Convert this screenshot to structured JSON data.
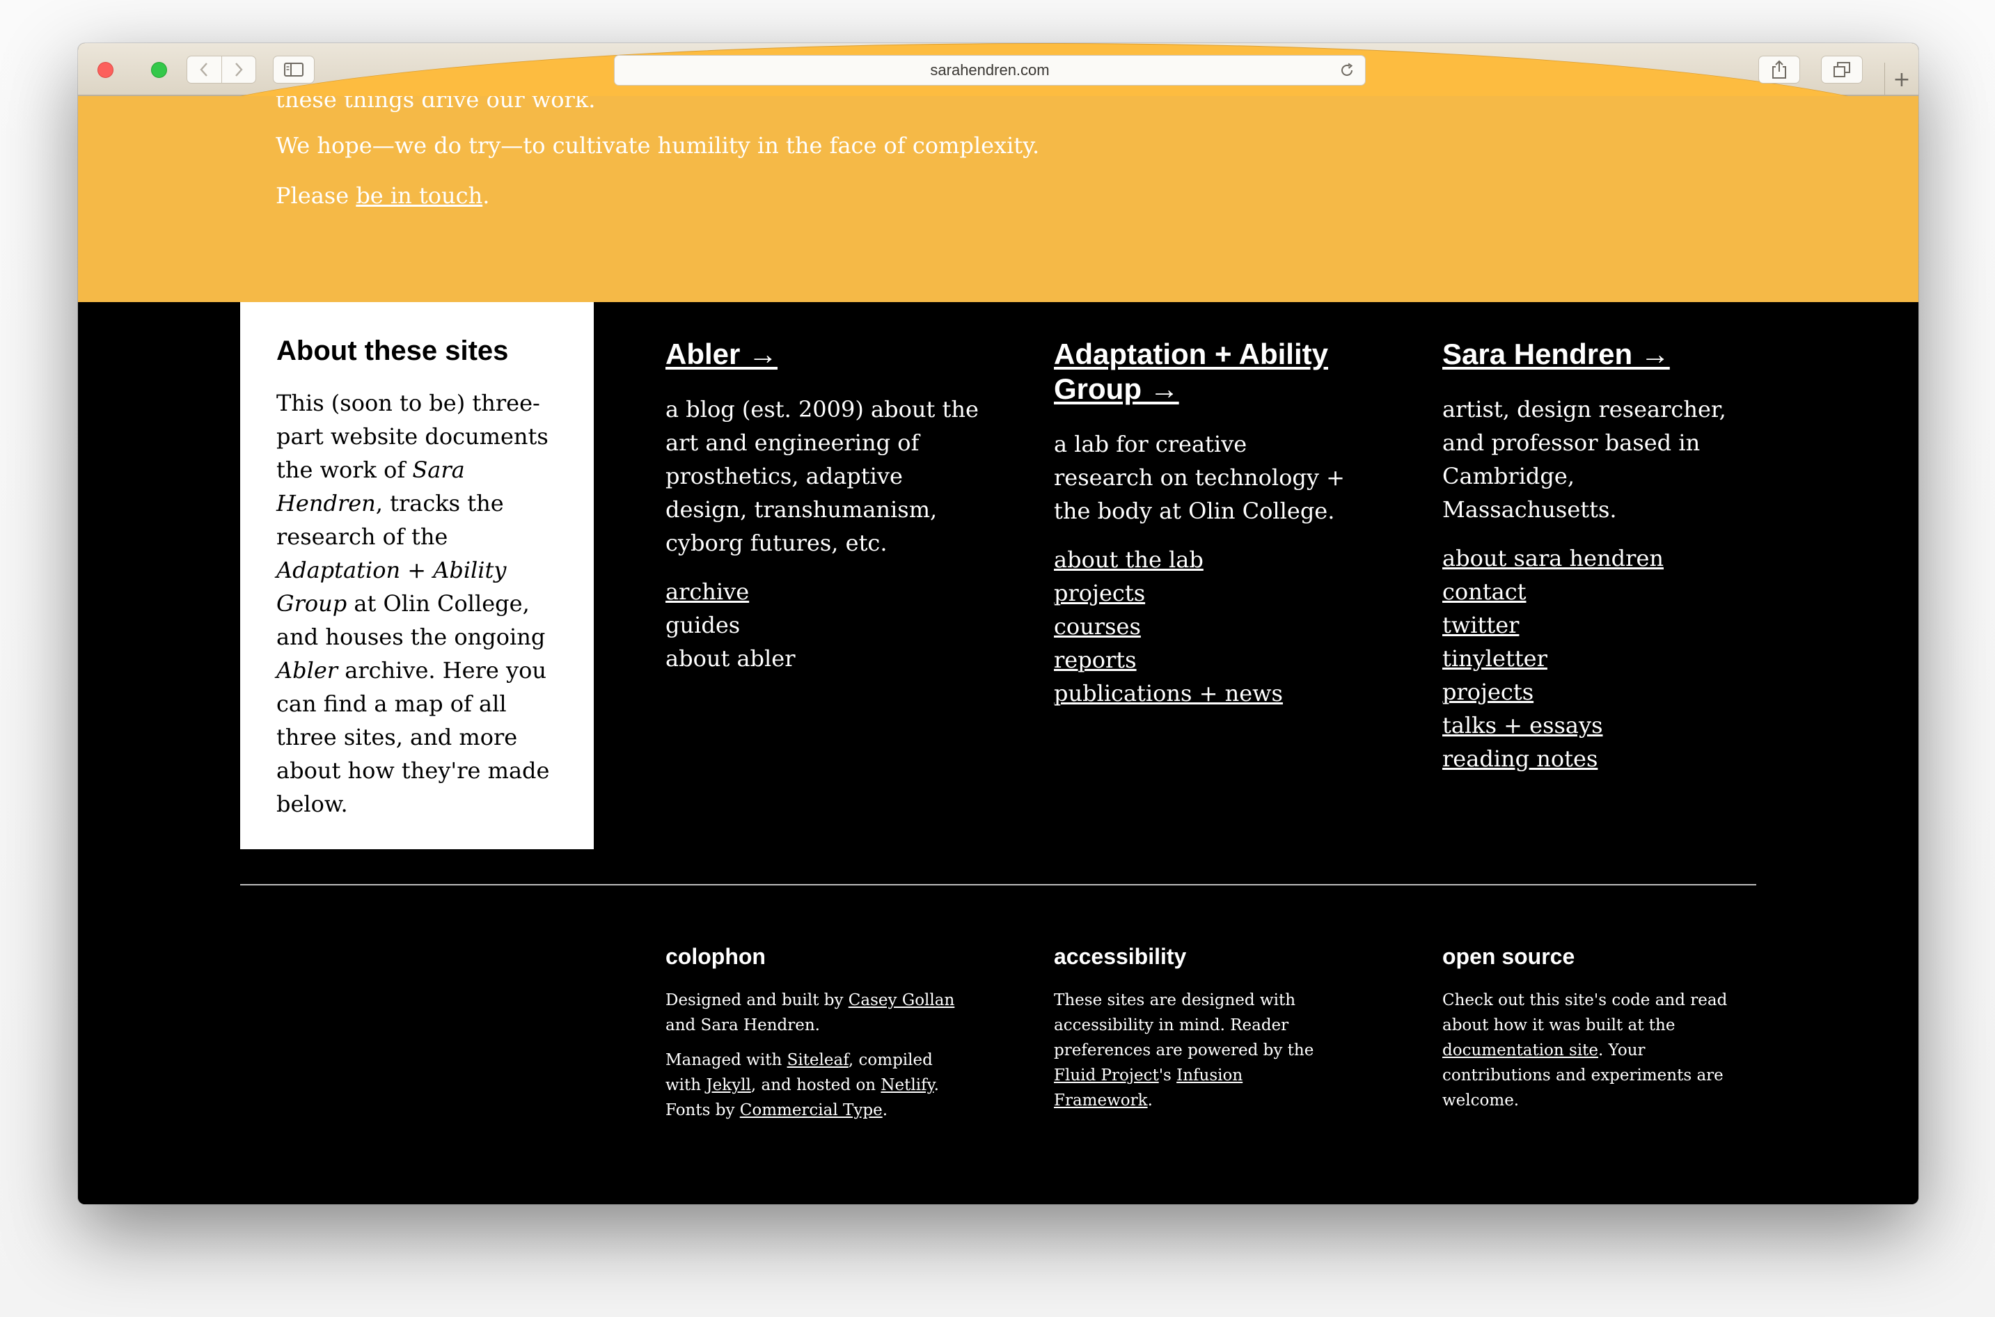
{
  "browser": {
    "url": "sarahendren.com"
  },
  "hero": {
    "partial_line": "these things drive our work.",
    "humility_line": "We hope—we do try—to cultivate humility in the face of complexity.",
    "contact_prefix": "Please ",
    "contact_link": "be in touch",
    "contact_suffix": "."
  },
  "about": {
    "title": "About these sites",
    "body_1": "This (soon to be) three-part website documents the work of ",
    "em_1": "Sara Hendren",
    "body_2": ", tracks the research of the ",
    "em_2": "Adaptation + Ability Group",
    "body_3": " at Olin College, and houses the ongoing ",
    "em_3": "Abler",
    "body_4": " archive. Here you can find a map of all three sites, and more about how they're made below."
  },
  "columns": [
    {
      "title": "Abler →",
      "description": "a blog (est. 2009) about the art and engineering of prosthetics, adaptive design, transhumanism, cyborg futures, etc.",
      "links": [
        "archive",
        "guides",
        "about abler"
      ]
    },
    {
      "title": "Adaptation + Ability Group →",
      "description": "a lab for creative research on technology + the body at Olin College.",
      "links": [
        "about the lab",
        "projects",
        "courses",
        "reports",
        "publications + news"
      ]
    },
    {
      "title": "Sara Hendren →",
      "description": "artist, design researcher, and professor based in Cambridge, Massachusetts.",
      "links": [
        "about sara hendren",
        "contact",
        "twitter",
        "tinyletter",
        "projects",
        "talks + essays",
        "reading notes"
      ]
    }
  ],
  "footer": {
    "colophon": {
      "title": "colophon",
      "p1_a": "Designed and built by ",
      "p1_link": "Casey Gollan",
      "p1_b": " and Sara Hendren.",
      "p2_a": "Managed with ",
      "p2_link1": "Siteleaf",
      "p2_b": ", compiled with ",
      "p2_link2": "Jekyll",
      "p2_c": ", and hosted on ",
      "p2_link3": "Netlify",
      "p2_d": ". Fonts by ",
      "p2_link4": "Commercial Type",
      "p2_e": "."
    },
    "accessibility": {
      "title": "accessibility",
      "p_a": "These sites are designed with accessibility in mind. Reader preferences are powered by the ",
      "p_link1": "Fluid Project",
      "p_b": "'s ",
      "p_link2": "Infusion Framework",
      "p_c": "."
    },
    "open_source": {
      "title": "open source",
      "p_a": "Check out this site's code and read about how it was built at the ",
      "p_link": "documentation site",
      "p_b": ". Your contributions and experiments are welcome."
    }
  }
}
